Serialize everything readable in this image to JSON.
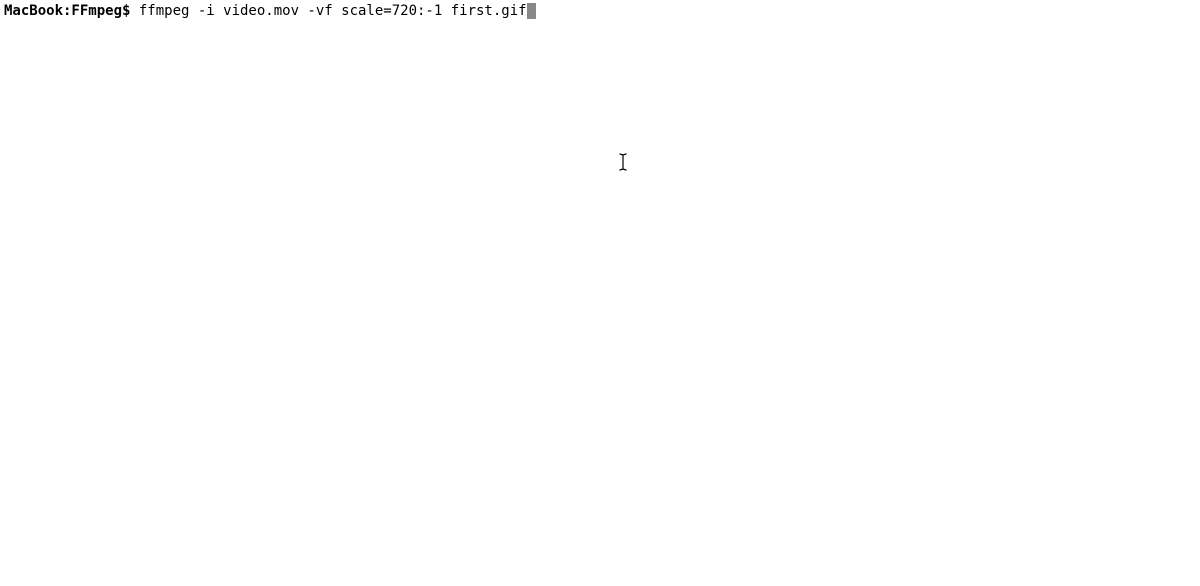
{
  "terminal": {
    "prompt": "MacBook:FFmpeg$ ",
    "command": "ffmpeg -i video.mov -vf scale=720:-1 first.gif"
  }
}
